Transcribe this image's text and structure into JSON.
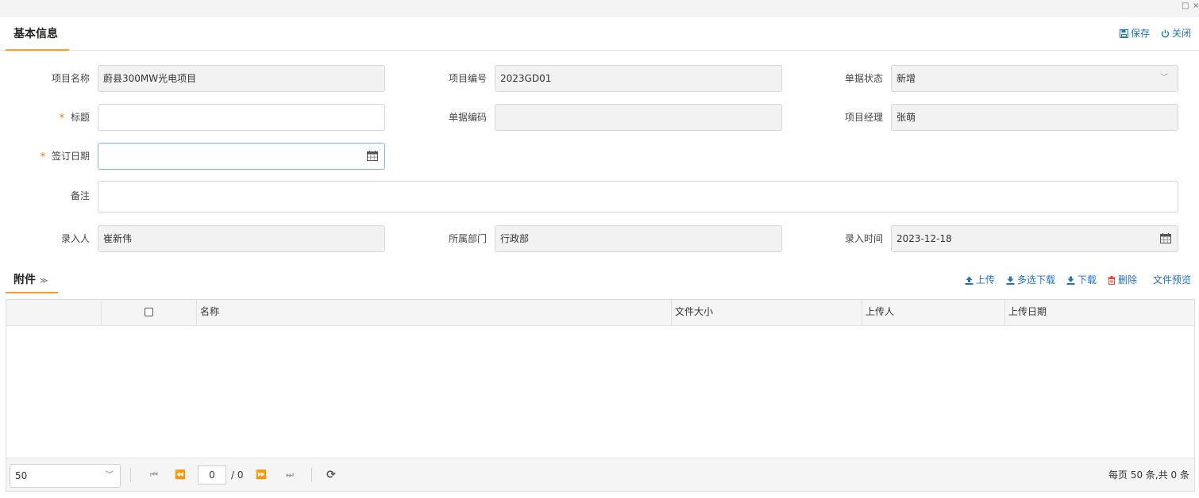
{
  "window": {
    "restore_glyph": "□",
    "close_glyph": "×"
  },
  "basic_section": {
    "title": "基本信息",
    "actions": {
      "save": "保存",
      "close": "关闭"
    }
  },
  "form": {
    "project_name": {
      "label": "项目名称",
      "value": "蔚县300MW光电项目"
    },
    "project_code": {
      "label": "项目编号",
      "value": "2023GD01"
    },
    "doc_status": {
      "label": "单据状态",
      "value": "新增"
    },
    "title": {
      "label": "标题",
      "required_mark": "*",
      "value": ""
    },
    "doc_code": {
      "label": "单据编码",
      "value": ""
    },
    "project_manager": {
      "label": "项目经理",
      "value": "张萌"
    },
    "sign_date": {
      "label": "签订日期",
      "required_mark": "*",
      "value": ""
    },
    "remark": {
      "label": "备注",
      "value": ""
    },
    "entered_by": {
      "label": "录入人",
      "value": "崔新伟"
    },
    "department": {
      "label": "所属部门",
      "value": "行政部"
    },
    "entry_time": {
      "label": "录入时间",
      "value": "2023-12-18"
    }
  },
  "attachments": {
    "title": "附件",
    "toggle_glyph": "≫",
    "actions": {
      "upload": "上传",
      "multi_download": "多选下载",
      "download": "下载",
      "delete": "删除",
      "preview": "文件预览"
    },
    "columns": [
      "名称",
      "文件大小",
      "上传人",
      "上传日期"
    ],
    "rows": [],
    "pager": {
      "page_size": "50",
      "current_page": "0",
      "total_pages": "/ 0",
      "summary": "每页 50 条,共 0 条"
    }
  },
  "colors": {
    "accent_orange": "#f39a3b",
    "link_blue": "#1e72c8",
    "danger_red": "#e6443f"
  }
}
